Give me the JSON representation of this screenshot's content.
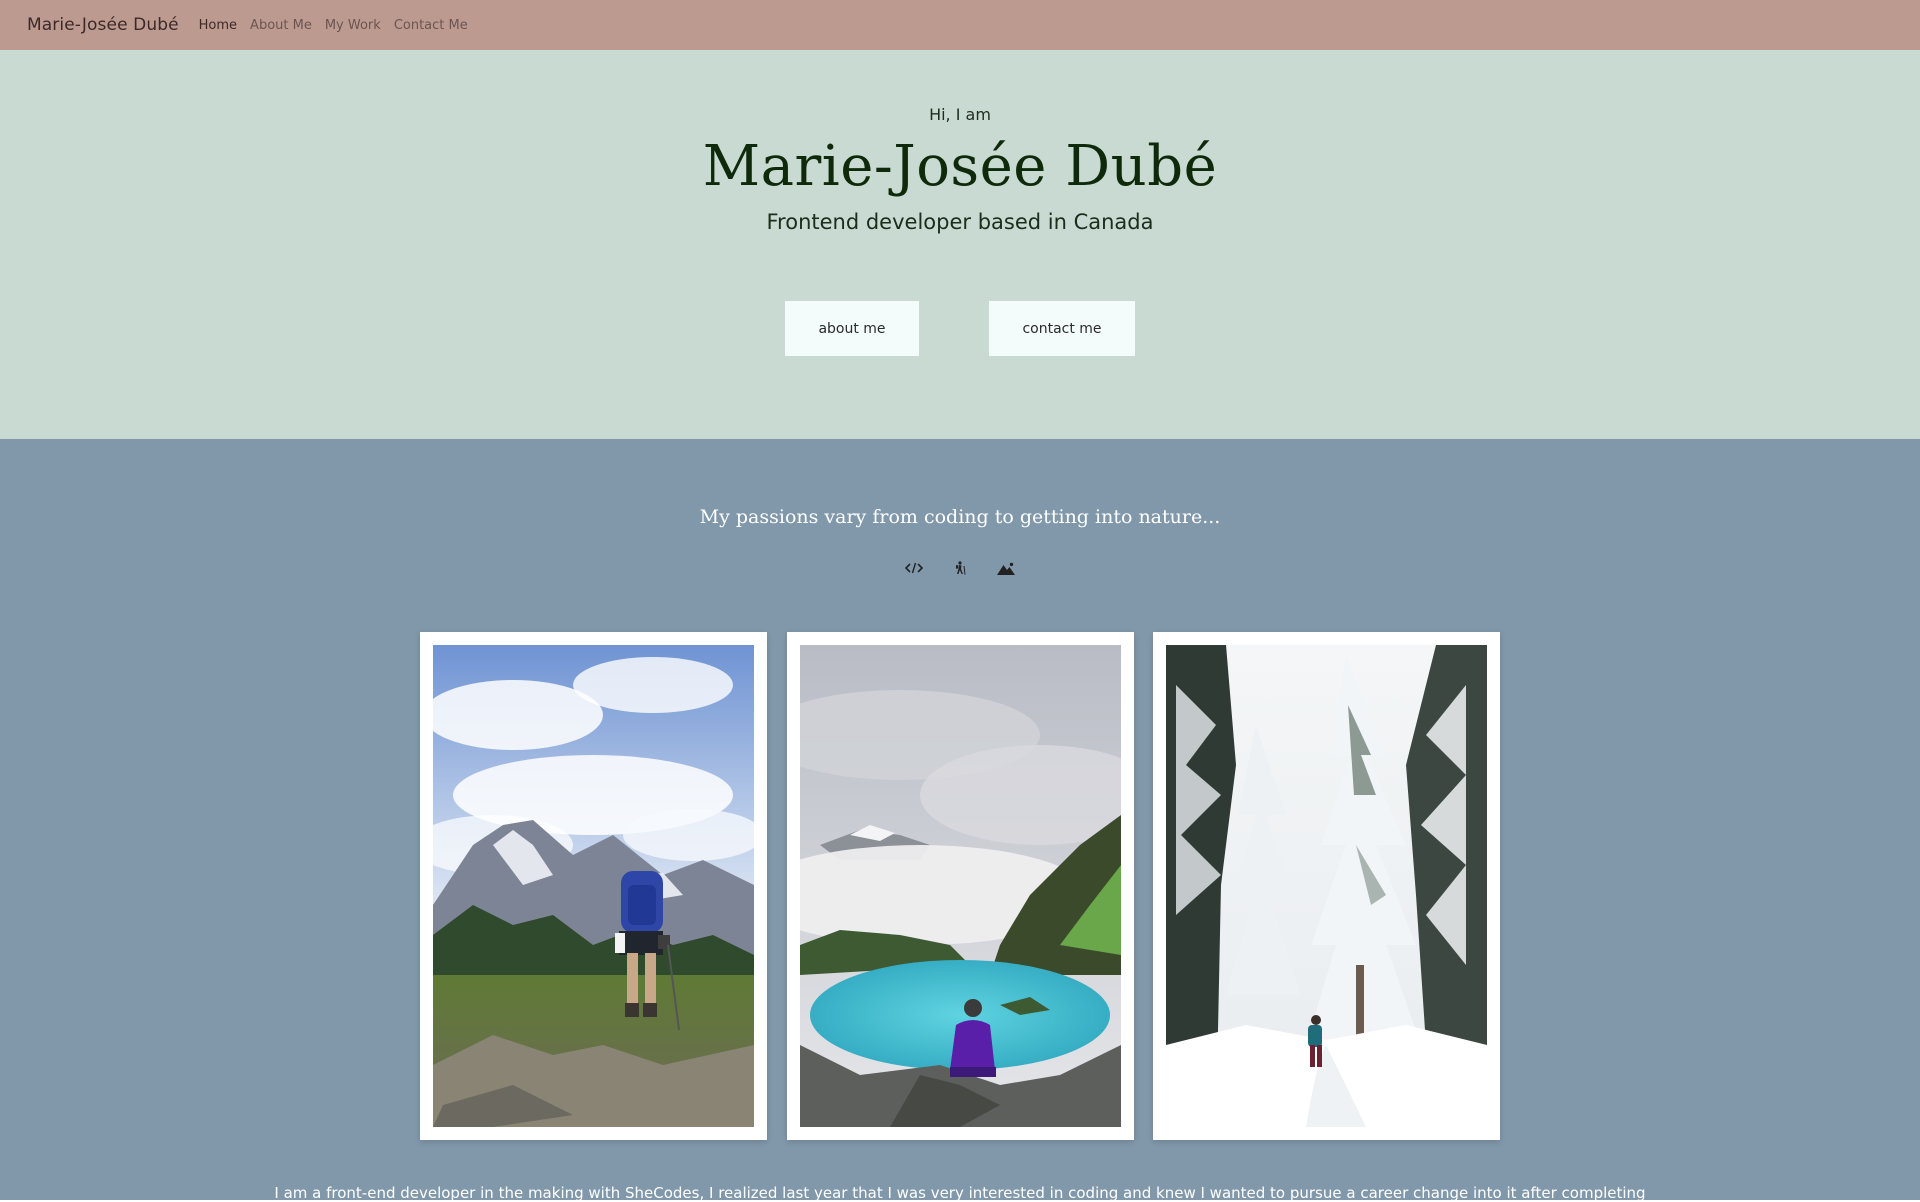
{
  "nav": {
    "brand": "Marie-Josée Dubé",
    "links": [
      {
        "label": "Home",
        "active": true
      },
      {
        "label": "About Me",
        "active": false
      },
      {
        "label": "My Work",
        "active": false
      },
      {
        "label": "Contact Me",
        "active": false
      }
    ]
  },
  "hero": {
    "greeting": "Hi, I am",
    "name": "Marie-Josée Dubé",
    "subtitle": "Frontend developer based in Canada",
    "buttons": {
      "about": "about me",
      "contact": "contact me"
    }
  },
  "passions": {
    "title": "My passions vary from coding to getting into nature...",
    "icons": [
      "code-icon",
      "hiking-icon",
      "mountain-icon"
    ],
    "photos": [
      {
        "name": "hiker-mountain-photo"
      },
      {
        "name": "lake-view-photo"
      },
      {
        "name": "snowy-forest-photo"
      }
    ],
    "about_text": "I am a front-end developer in the making with SheCodes, I realized last year that I was very interested in coding and knew I wanted to pursue a career change into it after completing"
  },
  "colors": {
    "navbar": "#bd9a90",
    "hero_bg": "#c8dad1",
    "passions_bg": "#8198ab",
    "button_bg": "#f3fcfb",
    "name_color": "#0e2a0a"
  }
}
